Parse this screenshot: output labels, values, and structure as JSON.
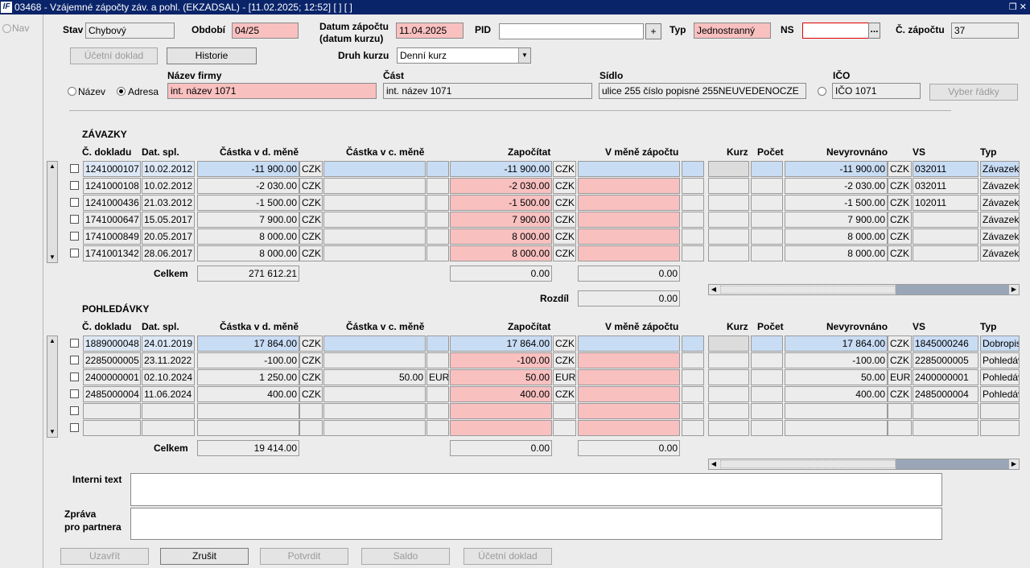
{
  "window": {
    "title": "03468 - Vzájemné zápočty záv. a pohl. (EKZADSAL) - [11.02.2025; 12:52]  [ ]  [ ]",
    "logo": "IF"
  },
  "left": {
    "nav_label": "Nav"
  },
  "form": {
    "stav_label": "Stav",
    "stav_value": "Chybový",
    "obdobi_label": "Období",
    "obdobi_value": "04/25",
    "datum_label_1": "Datum zápočtu",
    "datum_label_2": "(datum kurzu)",
    "datum_value": "11.04.2025",
    "pid_label": "PID",
    "pid_value": "",
    "pid_plus": "+",
    "typ_label": "Typ",
    "typ_value": "Jednostranný",
    "ns_label": "NS",
    "ns_value": "",
    "ns_more": "...",
    "cislo_label": "Č. zápočtu",
    "cislo_value": "37",
    "ucetni_doklad_btn": "Účetní doklad",
    "historie_btn": "Historie",
    "druh_kurzu_label": "Druh kurzu",
    "druh_kurzu_value": "Denní kurz",
    "radio_nazev": "Název",
    "radio_adresa": "Adresa",
    "nazev_firmy_label": "Název firmy",
    "nazev_firmy_value": "int. název 1071",
    "cast_label": "Část",
    "cast_value": "int. název 1071",
    "sidlo_label": "Sídlo",
    "sidlo_value": "ulice 255 číslo popisné 255NEUVEDENOCZE",
    "ico_label": "IČO",
    "ico_value": "IČO 1071",
    "vyber_radky_btn": "Vyber řádky"
  },
  "columns": {
    "cdokladu": "Č. dokladu",
    "datspl": "Dat. spl.",
    "castka_dm": "Částka v d. měně",
    "castka_cm": "Částka v c. měně",
    "zapocitat": "Započítat",
    "v_mene": "V měně zápočtu",
    "kurz": "Kurz",
    "pocet": "Počet",
    "nevyrovnano": "Nevyrovnáno",
    "vs": "VS",
    "typ": "Typ"
  },
  "zavazky": {
    "title": "ZÁVAZKY",
    "rows": [
      {
        "doc": "1241000107",
        "date": "10.02.2012",
        "amount": "-11 900.00",
        "cur": "CZK",
        "amount_c": "",
        "cur_c": "",
        "zap": "-11 900.00",
        "zcur": "CZK",
        "vm": "",
        "nev": "-11 900.00",
        "ncur": "CZK",
        "vs": "032011",
        "typ": "Závazek"
      },
      {
        "doc": "1241000108",
        "date": "10.02.2012",
        "amount": "-2 030.00",
        "cur": "CZK",
        "amount_c": "",
        "cur_c": "",
        "zap": "-2 030.00",
        "zcur": "CZK",
        "vm": "",
        "nev": "-2 030.00",
        "ncur": "CZK",
        "vs": "032011",
        "typ": "Závazek"
      },
      {
        "doc": "1241000436",
        "date": "21.03.2012",
        "amount": "-1 500.00",
        "cur": "CZK",
        "amount_c": "",
        "cur_c": "",
        "zap": "-1 500.00",
        "zcur": "CZK",
        "vm": "",
        "nev": "-1 500.00",
        "ncur": "CZK",
        "vs": "102011",
        "typ": "Závazek"
      },
      {
        "doc": "1741000647",
        "date": "15.05.2017",
        "amount": "7 900.00",
        "cur": "CZK",
        "amount_c": "",
        "cur_c": "",
        "zap": "7 900.00",
        "zcur": "CZK",
        "vm": "",
        "nev": "7 900.00",
        "ncur": "CZK",
        "vs": "",
        "typ": "Závazek"
      },
      {
        "doc": "1741000849",
        "date": "20.05.2017",
        "amount": "8 000.00",
        "cur": "CZK",
        "amount_c": "",
        "cur_c": "",
        "zap": "8 000.00",
        "zcur": "CZK",
        "vm": "",
        "nev": "8 000.00",
        "ncur": "CZK",
        "vs": "",
        "typ": "Závazek"
      },
      {
        "doc": "1741001342",
        "date": "28.06.2017",
        "amount": "8 000.00",
        "cur": "CZK",
        "amount_c": "",
        "cur_c": "",
        "zap": "8 000.00",
        "zcur": "CZK",
        "vm": "",
        "nev": "8 000.00",
        "ncur": "CZK",
        "vs": "",
        "typ": "Závazek"
      }
    ],
    "celkem_label": "Celkem",
    "celkem_value": "271 612.21",
    "zap_total": "0.00",
    "vm_total": "0.00"
  },
  "rozdil": {
    "label": "Rozdíl",
    "value": "0.00"
  },
  "pohledavky": {
    "title": "POHLEDÁVKY",
    "rows": [
      {
        "doc": "1889000048",
        "date": "24.01.2019",
        "amount": "17 864.00",
        "cur": "CZK",
        "amount_c": "",
        "cur_c": "",
        "zap": "17 864.00",
        "zcur": "CZK",
        "vm": "",
        "nev": "17 864.00",
        "ncur": "CZK",
        "vs": "1845000246",
        "typ": "Dobropis"
      },
      {
        "doc": "2285000005",
        "date": "23.11.2022",
        "amount": "-100.00",
        "cur": "CZK",
        "amount_c": "",
        "cur_c": "",
        "zap": "-100.00",
        "zcur": "CZK",
        "vm": "",
        "nev": "-100.00",
        "ncur": "CZK",
        "vs": "2285000005",
        "typ": "Pohledávka"
      },
      {
        "doc": "2400000001",
        "date": "02.10.2024",
        "amount": "1 250.00",
        "cur": "CZK",
        "amount_c": "50.00",
        "cur_c": "EUR",
        "zap": "50.00",
        "zcur": "EUR",
        "vm": "",
        "nev": "50.00",
        "ncur": "EUR",
        "vs": "2400000001",
        "typ": "Pohledávka"
      },
      {
        "doc": "2485000004",
        "date": "11.06.2024",
        "amount": "400.00",
        "cur": "CZK",
        "amount_c": "",
        "cur_c": "",
        "zap": "400.00",
        "zcur": "CZK",
        "vm": "",
        "nev": "400.00",
        "ncur": "CZK",
        "vs": "2485000004",
        "typ": "Pohledávka"
      },
      {
        "doc": "",
        "date": "",
        "amount": "",
        "cur": "",
        "amount_c": "",
        "cur_c": "",
        "zap": "",
        "zcur": "",
        "vm": "",
        "nev": "",
        "ncur": "",
        "vs": "",
        "typ": ""
      },
      {
        "doc": "",
        "date": "",
        "amount": "",
        "cur": "",
        "amount_c": "",
        "cur_c": "",
        "zap": "",
        "zcur": "",
        "vm": "",
        "nev": "",
        "ncur": "",
        "vs": "",
        "typ": ""
      }
    ],
    "celkem_label": "Celkem",
    "celkem_value": "19 414.00",
    "zap_total": "0.00",
    "vm_total": "0.00"
  },
  "bottom": {
    "interni_label": "Interni text",
    "interni_value": "",
    "zprava_label_1": "Zpráva",
    "zprava_label_2": "pro partnera",
    "zprava_value": "",
    "buttons": {
      "uzavrit": "Uzavřít",
      "zrusit": "Zrušit",
      "potvrdit": "Potvrdit",
      "saldo": "Saldo",
      "ucetni": "Účetní doklad"
    }
  },
  "colors": {
    "title_bar": "#0a246a",
    "pink": "#f9c0c0",
    "selected_blue": "#c8dcf4",
    "background": "#ececec"
  }
}
